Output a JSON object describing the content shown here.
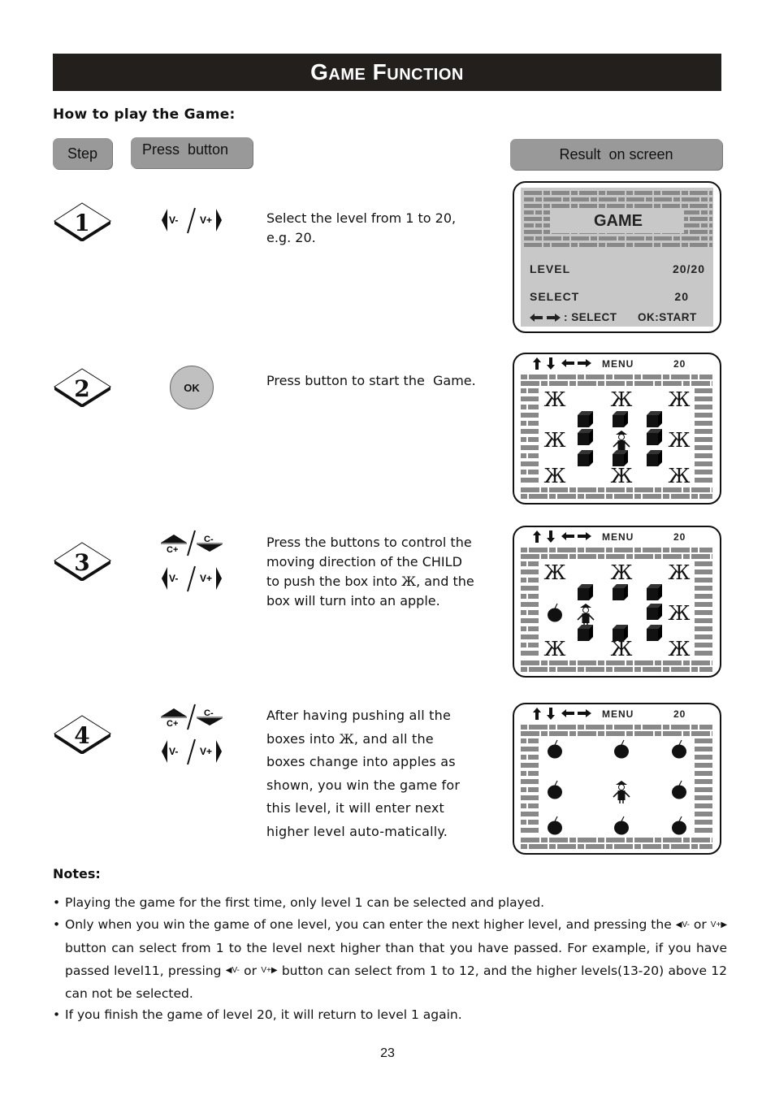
{
  "header": {
    "title": "Game Function"
  },
  "section": {
    "heading": "How to play the Game:"
  },
  "columns": {
    "step": "Step",
    "press": "Press  button",
    "result": "Result  on screen"
  },
  "steps": [
    {
      "number": "1",
      "keys": [
        "V-",
        "V+"
      ],
      "description": "Select the level from 1 to 20, e.g. 20."
    },
    {
      "number": "2",
      "keys": [
        "OK"
      ],
      "description": "Press button to start the  Game."
    },
    {
      "number": "3",
      "keys": [
        "C+",
        "C-",
        "V-",
        "V+"
      ],
      "description_parts": [
        "Press the buttons to control the moving direction of the CHILD to push the box into ",
        "Ж",
        ", and the box will turn into an apple."
      ]
    },
    {
      "number": "4",
      "keys": [
        "C+",
        "C-",
        "V-",
        "V+"
      ],
      "description_parts": [
        "After having pushing all the boxes into ",
        "Ж",
        ", and all the boxes change into apples as shown, you win the game for this level, it will enter next higher level auto-matically."
      ]
    }
  ],
  "screens": {
    "menu_screen": {
      "title": "GAME",
      "level_label": "LEVEL",
      "level_value": "20/20",
      "select_label": "SELECT",
      "select_value": "20",
      "hint_select": ": SELECT",
      "hint_start": "OK:START"
    },
    "game_screen": {
      "menu_label": "MENU",
      "level": "20",
      "target_glyph": "Ж"
    }
  },
  "notes": {
    "title": "Notes:",
    "items": [
      "Playing the game for the first time, only level 1 can be selected and played.",
      "Only when you win the game of one level, you can enter the next higher level, and pressing the V- or V+ button can select from 1 to the level next higher than that you have passed. For example, if you have passed level11, pressing V- or V+ button can select from 1 to 12, and the higher levels(13-20) above 12 can not be selected.",
      "If you finish the game of level 20, it will return to level 1 again."
    ],
    "note2_parts": [
      "Only when you win the game of one level, you can enter the next higher level, and pressing the ",
      " or ",
      " button can select from 1 to the level next higher than that you have passed. For example, if you have passed level11, pressing ",
      " or ",
      " button can select from 1 to 12, and the higher levels(13-20) above 12 can not be selected."
    ],
    "key_vminus": "V-",
    "key_vplus": "V+"
  },
  "footer": {
    "page_number": "23"
  }
}
